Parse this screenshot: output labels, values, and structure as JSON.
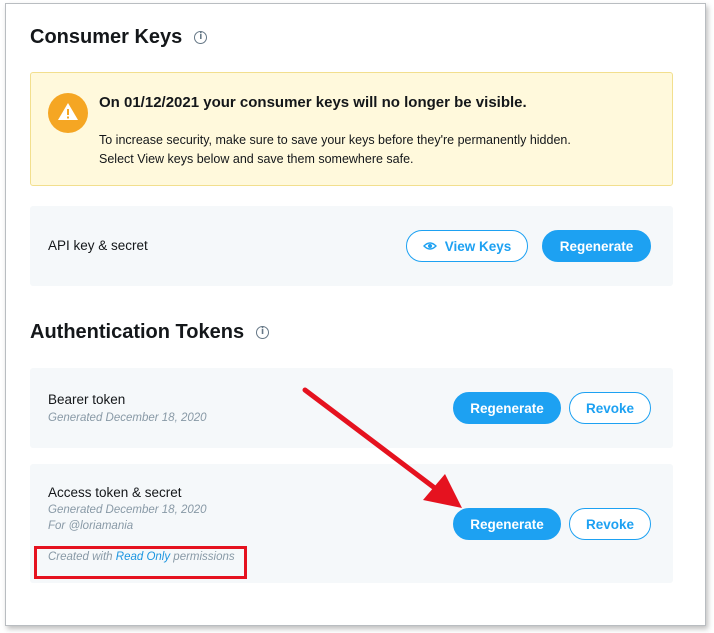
{
  "consumer_keys": {
    "title": "Consumer Keys",
    "warning": {
      "title": "On 01/12/2021 your consumer keys will no longer be visible.",
      "line1": "To increase security, make sure to save your keys before they're permanently hidden.",
      "line2": "Select View keys below and save them somewhere safe."
    },
    "api_key": {
      "label": "API key & secret",
      "view_keys_label": "View Keys",
      "regenerate_label": "Regenerate"
    }
  },
  "auth_tokens": {
    "title": "Authentication Tokens",
    "bearer": {
      "label": "Bearer token",
      "generated": "Generated December 18, 2020",
      "regenerate_label": "Regenerate",
      "revoke_label": "Revoke"
    },
    "access": {
      "label": "Access token & secret",
      "generated": "Generated December 18, 2020",
      "for_user": "For @loriamania",
      "perm_prefix": "Created with ",
      "perm_link": "Read Only",
      "perm_suffix": " permissions",
      "regenerate_label": "Regenerate",
      "revoke_label": "Revoke"
    }
  },
  "colors": {
    "accent": "#1da1f2",
    "warning_bg": "#fff9dc",
    "warning_icon": "#f5a623",
    "annotation": "#e5121f",
    "card_bg": "#f5f8fa"
  },
  "icons": {
    "info": "info-circle-icon",
    "warning": "warning-triangle-icon",
    "eye": "eye-icon"
  }
}
